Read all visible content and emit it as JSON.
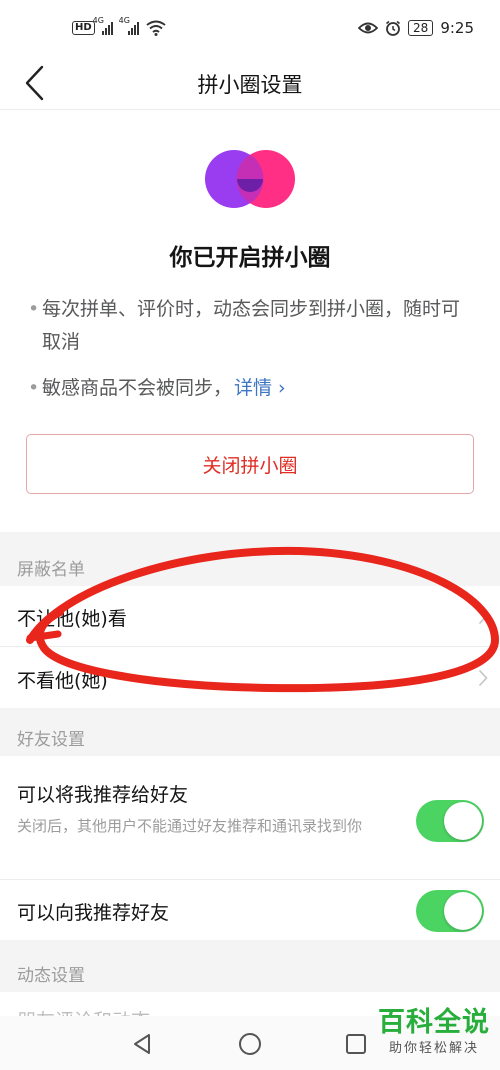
{
  "status_bar": {
    "hd": "HD",
    "net1": "4G",
    "net2": "4G",
    "battery": "28",
    "time": "9:25"
  },
  "nav": {
    "title": "拼小圈设置"
  },
  "hero": {
    "headline": "你已开启拼小圈",
    "bullet1": "每次拼单、评价时，动态会同步到拼小圈，随时可取消",
    "bullet2": "敏感商品不会被同步，",
    "bullet2_link": "详情 ›",
    "close_button": "关闭拼小圈"
  },
  "block_list": {
    "header": "屏蔽名单",
    "items": [
      {
        "label": "不让他(她)看"
      },
      {
        "label": "不看他(她)"
      }
    ]
  },
  "friend_settings": {
    "header": "好友设置",
    "recommend_me": {
      "label": "可以将我推荐给好友",
      "desc": "关闭后，其他用户不能通过好友推荐和通讯录找到你",
      "enabled": true
    },
    "recommend_to_me": {
      "label": "可以向我推荐好友",
      "enabled": true
    }
  },
  "moment_settings": {
    "header": "动态设置",
    "partial_item": "朋友评论和动态"
  },
  "watermark": {
    "main": "百科全说",
    "sub": "助你轻松解决"
  },
  "colors": {
    "accent_red": "#e02e24",
    "toggle_green": "#4cd463",
    "link_blue": "#3e75c2",
    "logo_purple": "#9a3cf0",
    "logo_pink": "#ff2f86",
    "annotation_red": "#e8261c"
  }
}
